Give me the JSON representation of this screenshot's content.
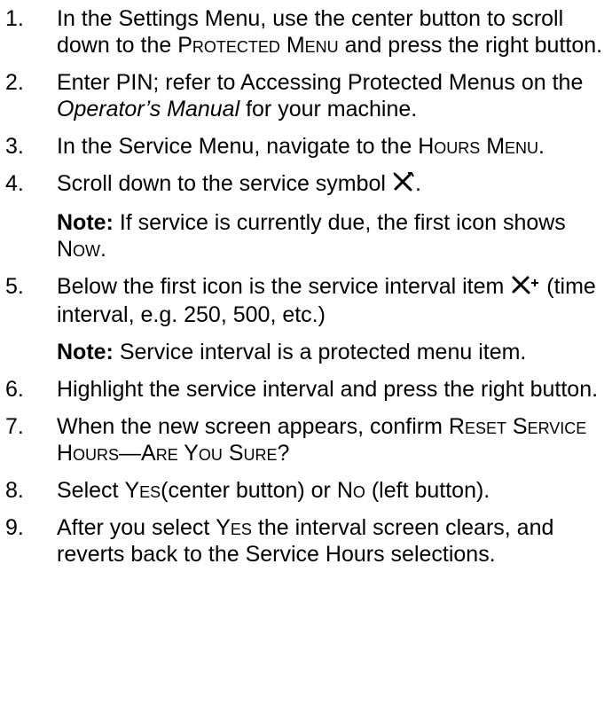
{
  "steps": [
    {
      "num": "1.",
      "a": "In the Settings Menu, use the center button to scroll down to the ",
      "menu": "Protected Menu",
      "b": " and press the right button."
    },
    {
      "num": "2.",
      "a": " Enter PIN; refer to Accessing Protected Menus on the ",
      "doc": "Operator’s Manual",
      "b": " for your machine."
    },
    {
      "num": "3.",
      "a": "In the Service Menu, navigate to the ",
      "menu": "Hours Menu",
      "b": "."
    },
    {
      "num": "4.",
      "a": "Scroll down to the service symbol ",
      "b": "."
    },
    {
      "num": "5.",
      "a": "Below the first icon is the service interval item ",
      "b": " (time interval, e.g. 250, 500, etc.)"
    },
    {
      "num": "6.",
      "a": "Highlight the service interval and press the right button."
    },
    {
      "num": "7.",
      "a": "When the new screen appears, confirm ",
      "menu": "Reset Service Hours—Are You Sure?"
    },
    {
      "num": "8.",
      "a": "Select ",
      "yes": "Yes",
      "b": "(center button) or ",
      "no": "No",
      "c": " (left button)."
    },
    {
      "num": "9.",
      "a": "After you select ",
      "yes": "Yes",
      "b": " the interval screen clears, and reverts back to the Service Hours selections."
    }
  ],
  "notes": [
    {
      "label": "Note:",
      "a": " If service is currently due, the first icon shows ",
      "now": "Now",
      "b": "."
    },
    {
      "label": "Note:",
      "a": " Service interval is a protected menu item."
    }
  ],
  "icons": {
    "service": "wrench-screwdriver-icon",
    "service_interval": "wrench-screwdriver-plus-icon"
  }
}
